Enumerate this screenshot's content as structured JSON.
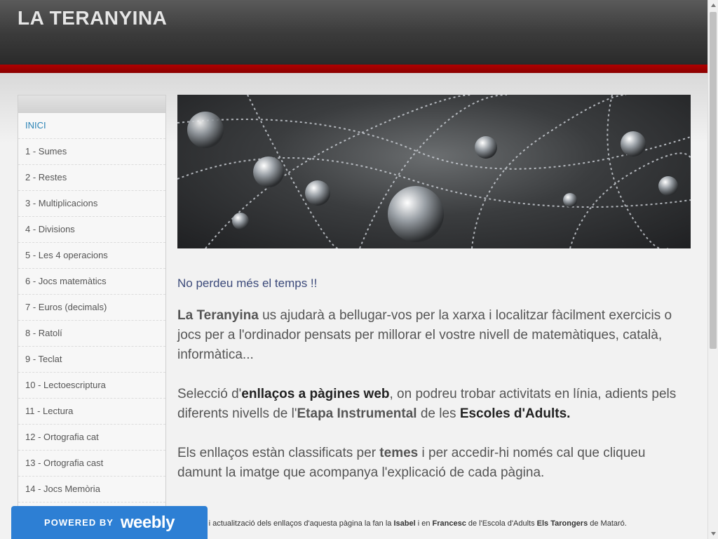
{
  "header": {
    "title": "LA TERANYINA"
  },
  "sidebar": {
    "items": [
      {
        "label": "INICI",
        "active": true
      },
      {
        "label": "1 - Sumes"
      },
      {
        "label": "2 - Restes"
      },
      {
        "label": "3 - Multiplicacions"
      },
      {
        "label": "4 - Divisions"
      },
      {
        "label": "5 - Les 4 operacions"
      },
      {
        "label": "6 - Jocs matemàtics"
      },
      {
        "label": "7 - Euros (decimals)"
      },
      {
        "label": "8 - Ratolí"
      },
      {
        "label": "9 - Teclat"
      },
      {
        "label": "10 - Lectoescriptura"
      },
      {
        "label": "11 - Lectura"
      },
      {
        "label": "12 - Ortografia cat"
      },
      {
        "label": "13 - Ortografia cast"
      },
      {
        "label": "14 - Jocs Memòria"
      }
    ]
  },
  "main": {
    "tagline": "No perdeu més el temps !!",
    "p1": {
      "bold": "La Teranyina",
      "text": " us ajudarà a bellugar-vos per la xarxa i localitzar fàcilment exercicis o jocs per a l'ordinador pensats per millorar el vostre nivell de matemàtiques, català, informàtica..."
    },
    "p2": {
      "t1": "Selecció d'",
      "b1": "enllaços a pàgines web",
      "t2": ", on podreu trobar activitats en línia, adients pels diferents nivells de l'",
      "b2": "Etapa Instrumental",
      "t3": " de  les ",
      "b3": "Escoles d'Adults",
      "t4": "."
    },
    "p3": {
      "t1": "Els enllaços estàn classificats per ",
      "b1": "temes",
      "t2": " i  per  accedir-hi només cal que cliqueu damunt la imatge que acompanya l'explicació de cada pàgina."
    },
    "credits": {
      "t1": "Selecció i actualització dels enllaços d'aquesta pàgina la fan la ",
      "b1": "Isabel",
      "t2": " i en ",
      "b2": "Francesc",
      "t3": " de l'Escola d'Adults ",
      "b3": "Els Tarongers",
      "t4": " de Mataró."
    }
  },
  "badge": {
    "powered": "POWERED BY",
    "brand": "weebly"
  },
  "colors": {
    "accent": "#2a83b5",
    "header_red": "#a00000",
    "badge_blue": "#2d7fd4"
  }
}
